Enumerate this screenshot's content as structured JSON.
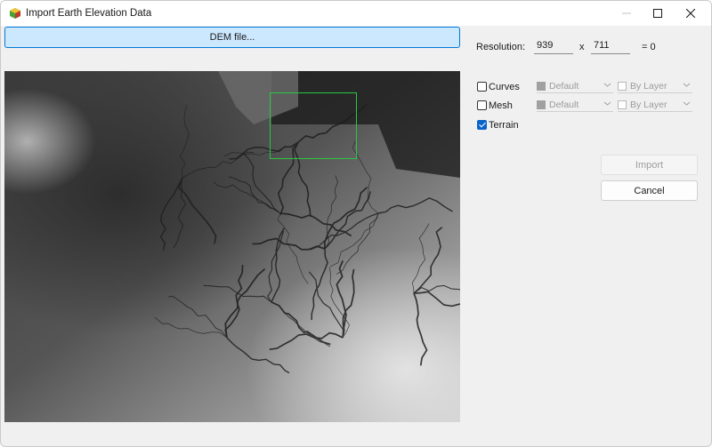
{
  "window": {
    "title": "Import Earth Elevation Data"
  },
  "dem_button_label": "DEM file...",
  "resolution": {
    "label": "Resolution:",
    "width": "939",
    "separator": "x",
    "height": "711",
    "result": "= 0"
  },
  "options": [
    {
      "label": "Curves",
      "checked": false,
      "color": "Default",
      "layer": "By Layer"
    },
    {
      "label": "Mesh",
      "checked": false,
      "color": "Default",
      "layer": "By Layer"
    },
    {
      "label": "Terrain",
      "checked": true
    }
  ],
  "buttons": {
    "import": "Import",
    "cancel": "Cancel"
  },
  "colors": {
    "accent": "#0078d4",
    "selection": "#27c93f",
    "button_highlight": "#cce8ff"
  }
}
